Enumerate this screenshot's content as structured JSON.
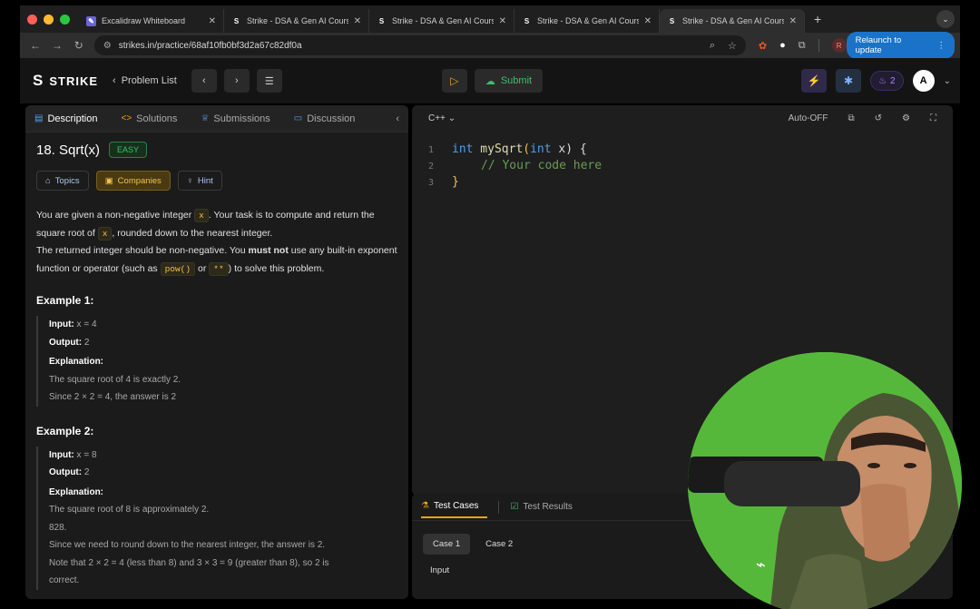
{
  "browser": {
    "tabs": [
      {
        "title": "Excalidraw Whiteboard",
        "fav": "excalidraw-icon",
        "active": false
      },
      {
        "title": "Strike - DSA & Gen AI Course",
        "fav": "strike-icon",
        "active": false
      },
      {
        "title": "Strike - DSA & Gen AI Course",
        "fav": "strike-icon",
        "active": false
      },
      {
        "title": "Strike - DSA & Gen AI Course",
        "fav": "strike-icon",
        "active": false
      },
      {
        "title": "Strike - DSA & Gen AI Course",
        "fav": "strike-icon",
        "active": true
      }
    ],
    "url": "strikes.in/practice/68af10fb0bf3d2a67c82df0a",
    "relaunch": "Relaunch to update",
    "profile_initial": "R"
  },
  "app": {
    "logo_text": "STRIKE",
    "problem_list": "Problem List",
    "submit": "Submit",
    "streak": "2",
    "avatar": "A"
  },
  "left": {
    "tabs": [
      "Description",
      "Solutions",
      "Submissions",
      "Discussion"
    ],
    "title": "18. Sqrt(x)",
    "difficulty": "EASY",
    "chips": [
      "Topics",
      "Companies",
      "Hint"
    ],
    "desc": {
      "p1a": "You are given a non-negative integer ",
      "x": "x",
      "p1b": ". Your task is to compute and return the square root of ",
      "p1c": ", rounded down to the nearest integer.",
      "p2a": "The returned integer should be non-negative. You ",
      "must_not": "must not",
      "p2b": " use any built-in exponent function or operator (such as ",
      "pow": "pow()",
      "or": " or ",
      "star": "**",
      "p2c": ") to solve this problem."
    },
    "examples": [
      {
        "heading": "Example 1:",
        "input_label": "Input:",
        "input": "x = 4",
        "output_label": "Output:",
        "output": "2",
        "expl_label": "Explanation:",
        "expl": [
          "The square root of 4 is exactly 2.",
          "Since 2 × 2 = 4, the answer is 2"
        ]
      },
      {
        "heading": "Example 2:",
        "input_label": "Input:",
        "input": "x = 8",
        "output_label": "Output:",
        "output": "2",
        "expl_label": "Explanation:",
        "expl": [
          "The square root of 8 is approximately 2.",
          "828.",
          "Since we need to round down to the nearest integer, the answer is 2.",
          "Note that 2 × 2 = 4 (less than 8) and 3 × 3 = 9 (greater than 8), so 2 is",
          "correct."
        ]
      }
    ]
  },
  "editor": {
    "language": "C++",
    "auto": "Auto-OFF",
    "lines": [
      {
        "n": "1",
        "kw1": "int",
        "fn": " mySqrt",
        "p1": "(",
        "kw2": "int",
        "rest": " x) {"
      },
      {
        "n": "2",
        "comment": "// Your code here"
      },
      {
        "n": "3",
        "close": "}"
      }
    ]
  },
  "bottom": {
    "tabs": [
      "Test Cases",
      "Test Results"
    ],
    "cases": [
      "Case 1",
      "Case 2"
    ],
    "input_label": "Input"
  }
}
